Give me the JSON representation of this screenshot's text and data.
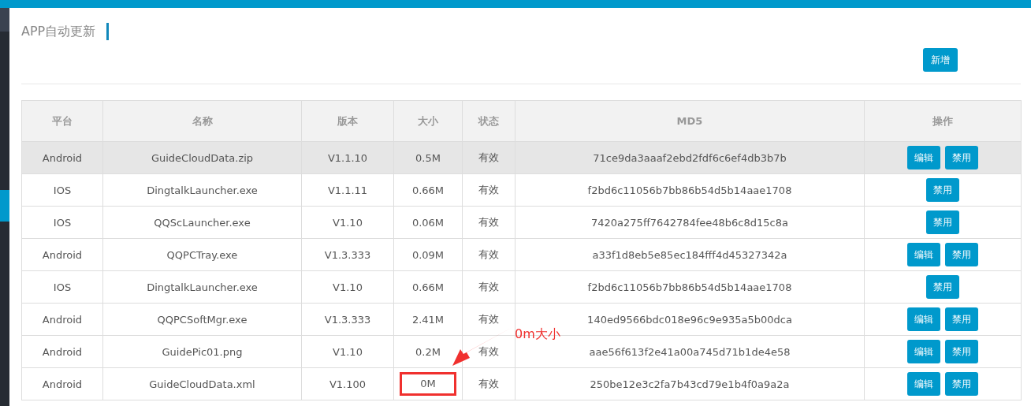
{
  "page": {
    "title": "APP自动更新",
    "add_button": "新增"
  },
  "table": {
    "columns": [
      "平台",
      "名称",
      "版本",
      "大小",
      "状态",
      "MD5",
      "操作"
    ],
    "rows": [
      {
        "platform": "Android",
        "name": "GuideCloudData.zip",
        "version": "V1.1.10",
        "size": "0.5M",
        "status": "有效",
        "md5": "71ce9da3aaaf2ebd2fdf6c6ef4db3b7b",
        "actions": [
          "编辑",
          "禁用"
        ],
        "highlighted": true,
        "size_marked": false
      },
      {
        "platform": "IOS",
        "name": "DingtalkLauncher.exe",
        "version": "V1.1.11",
        "size": "0.66M",
        "status": "有效",
        "md5": "f2bd6c11056b7bb86b54d5b14aae1708",
        "actions": [
          "禁用"
        ],
        "highlighted": false,
        "size_marked": false
      },
      {
        "platform": "IOS",
        "name": "QQScLauncher.exe",
        "version": "V1.10",
        "size": "0.06M",
        "status": "有效",
        "md5": "7420a275ff7642784fee48b6c8d15c8a",
        "actions": [
          "禁用"
        ],
        "highlighted": false,
        "size_marked": false
      },
      {
        "platform": "Android",
        "name": "QQPCTray.exe",
        "version": "V1.3.333",
        "size": "0.09M",
        "status": "有效",
        "md5": "a33f1d8eb5e85ec184fff4d45327342a",
        "actions": [
          "编辑",
          "禁用"
        ],
        "highlighted": false,
        "size_marked": false
      },
      {
        "platform": "IOS",
        "name": "DingtalkLauncher.exe",
        "version": "V1.10",
        "size": "0.66M",
        "status": "有效",
        "md5": "f2bd6c11056b7bb86b54d5b14aae1708",
        "actions": [
          "禁用"
        ],
        "highlighted": false,
        "size_marked": false
      },
      {
        "platform": "Android",
        "name": "QQPCSoftMgr.exe",
        "version": "V1.3.333",
        "size": "2.41M",
        "status": "有效",
        "md5": "140ed9566bdc018e96c9e935a5b00dca",
        "actions": [
          "编辑",
          "禁用"
        ],
        "highlighted": false,
        "size_marked": false
      },
      {
        "platform": "Android",
        "name": "GuidePic01.png",
        "version": "V1.10",
        "size": "0.2M",
        "status": "有效",
        "md5": "aae56f613f2e41a00a745d71b1de4e58",
        "actions": [
          "编辑",
          "禁用"
        ],
        "highlighted": false,
        "size_marked": false
      },
      {
        "platform": "Android",
        "name": "GuideCloudData.xml",
        "version": "V1.100",
        "size": "0M",
        "status": "有效",
        "md5": "250be12e3c2fa7b43cd79e1b4f0a9a2a",
        "actions": [
          "编辑",
          "禁用"
        ],
        "highlighted": false,
        "size_marked": true
      }
    ]
  },
  "annotation": {
    "text": "0m大小"
  }
}
